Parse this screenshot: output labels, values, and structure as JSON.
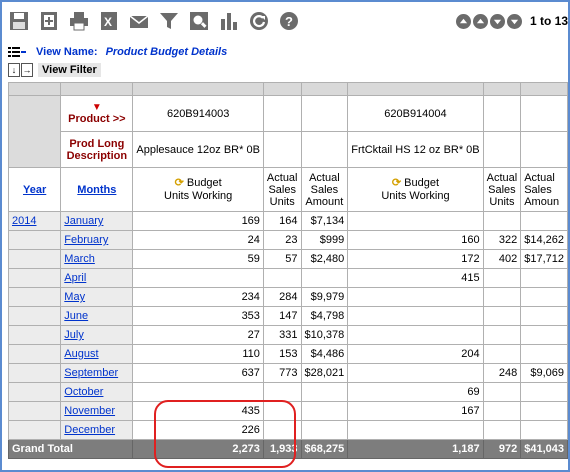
{
  "toolbar": {
    "icons": [
      "save-icon",
      "new-icon",
      "print-icon",
      "excel-icon",
      "email-icon",
      "filter-icon",
      "search-icon",
      "chart-icon",
      "refresh-icon",
      "help-icon"
    ],
    "page_text": "1 to 13"
  },
  "view": {
    "label": "View Name:",
    "name": "Product Budget Details",
    "filter_label": "View Filter"
  },
  "grid": {
    "product_label": "Product >>",
    "prod_long_label": "Prod Long Description",
    "products": [
      {
        "code": "620B914003",
        "desc": "Applesauce 12oz BR* 0B"
      },
      {
        "code": "620B914004",
        "desc": "FrtCktail HS 12 oz BR* 0B"
      }
    ],
    "col_year": "Year",
    "col_months": "Months",
    "col_budget": "Budget",
    "col_budget_sub": "Units Working",
    "col_actual_units": "Actual Sales Units",
    "col_actual_amount": "Actual Sales Amount",
    "col_actual_amount_cut": "Actual Sales Amoun",
    "year": "2014",
    "rows": [
      {
        "month": "January",
        "b1": "169",
        "u1": "164",
        "a1": "$7,134",
        "b2": "",
        "u2": "",
        "a2": ""
      },
      {
        "month": "February",
        "b1": "24",
        "u1": "23",
        "a1": "$999",
        "b2": "160",
        "u2": "322",
        "a2": "$14,262"
      },
      {
        "month": "March",
        "b1": "59",
        "u1": "57",
        "a1": "$2,480",
        "b2": "172",
        "u2": "402",
        "a2": "$17,712"
      },
      {
        "month": "April",
        "b1": "",
        "u1": "",
        "a1": "",
        "b2": "415",
        "u2": "",
        "a2": ""
      },
      {
        "month": "May",
        "b1": "234",
        "u1": "284",
        "a1": "$9,979",
        "b2": "",
        "u2": "",
        "a2": ""
      },
      {
        "month": "June",
        "b1": "353",
        "u1": "147",
        "a1": "$4,798",
        "b2": "",
        "u2": "",
        "a2": ""
      },
      {
        "month": "July",
        "b1": "27",
        "u1": "331",
        "a1": "$10,378",
        "b2": "",
        "u2": "",
        "a2": ""
      },
      {
        "month": "August",
        "b1": "110",
        "u1": "153",
        "a1": "$4,486",
        "b2": "204",
        "u2": "",
        "a2": ""
      },
      {
        "month": "September",
        "b1": "637",
        "u1": "773",
        "a1": "$28,021",
        "b2": "",
        "u2": "248",
        "a2": "$9,069"
      },
      {
        "month": "October",
        "b1": "",
        "u1": "",
        "a1": "",
        "b2": "69",
        "u2": "",
        "a2": ""
      },
      {
        "month": "November",
        "b1": "435",
        "u1": "",
        "a1": "",
        "b2": "167",
        "u2": "",
        "a2": ""
      },
      {
        "month": "December",
        "b1": "226",
        "u1": "",
        "a1": "",
        "b2": "",
        "u2": "",
        "a2": ""
      }
    ],
    "total": {
      "label": "Grand Total",
      "b1": "2,273",
      "u1": "1,933",
      "a1": "$68,275",
      "b2": "1,187",
      "u2": "972",
      "a2": "$41,043"
    }
  },
  "colors": {
    "link": "#0033cc",
    "header_red": "#8b0000",
    "total_bg": "#7d7d7d",
    "highlight": "#e02020",
    "frame": "#5b8bd0"
  }
}
